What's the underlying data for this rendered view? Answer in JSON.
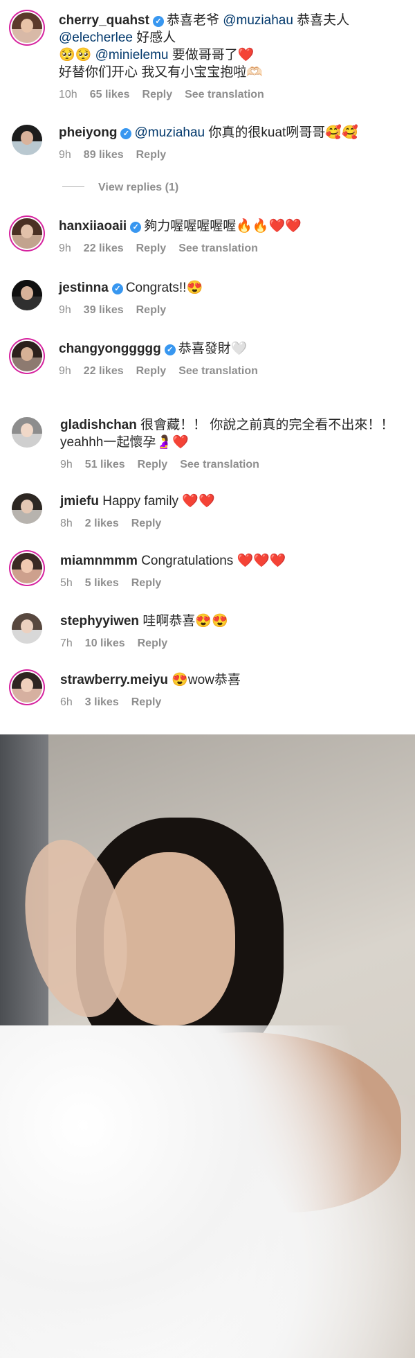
{
  "comments": [
    {
      "username": "cherry_quahst",
      "verified": true,
      "text_parts": [
        "恭喜老爷 ",
        "@muziahau",
        " 恭喜夫人"
      ],
      "line2_parts": [
        "@elecherlee",
        " 好感人"
      ],
      "line3_parts": [
        "🥺🥺 ",
        "@minielemu",
        " 要做哥哥了",
        "❤️"
      ],
      "line4": "好替你们开心 我又有小宝宝抱啦🫶🏻",
      "time": "10h",
      "likes": "65 likes",
      "reply": "Reply",
      "translation": "See translation"
    },
    {
      "username": "pheiyong",
      "verified": true,
      "text_parts": [
        "@muziahau",
        " 你真的很kuat咧哥哥🥰🥰"
      ],
      "time": "9h",
      "likes": "89 likes",
      "reply": "Reply"
    },
    {
      "view_replies": "View replies (1)"
    },
    {
      "username": "hanxiiaoaii",
      "verified": true,
      "text": "夠力喔喔喔喔喔🔥🔥❤️❤️",
      "time": "9h",
      "likes": "22 likes",
      "reply": "Reply",
      "translation": "See translation"
    },
    {
      "username": "jestinna",
      "verified": true,
      "text": "Congrats!!😍",
      "time": "9h",
      "likes": "39 likes",
      "reply": "Reply"
    },
    {
      "username": "changyonggggg",
      "verified": true,
      "text": "恭喜發財🤍",
      "time": "9h",
      "likes": "22 likes",
      "reply": "Reply",
      "translation": "See translation"
    },
    {
      "username": "gladishchan",
      "verified": false,
      "text": "很會藏！！ 你說之前真的完全看不出來！！",
      "text2": "yeahhh一起懷孕🤰❤️",
      "time": "9h",
      "likes": "51 likes",
      "reply": "Reply",
      "translation": "See translation"
    },
    {
      "username": "jmiefu",
      "verified": false,
      "text": "Happy family ❤️❤️",
      "time": "8h",
      "likes": "2 likes",
      "reply": "Reply"
    },
    {
      "username": "miamnmmm",
      "verified": false,
      "text": "Congratulations ❤️❤️❤️",
      "time": "5h",
      "likes": "5 likes",
      "reply": "Reply"
    },
    {
      "username": "stephyyiwen",
      "verified": false,
      "text": "哇啊恭喜😍😍",
      "time": "7h",
      "likes": "10 likes",
      "reply": "Reply"
    },
    {
      "username": "strawberry.meiyu",
      "verified": false,
      "text": "😍wow恭喜",
      "time": "6h",
      "likes": "3 likes",
      "reply": "Reply"
    }
  ],
  "colors": {
    "mention": "#00376b",
    "muted": "#8e8e8e",
    "verified": "#3897f0",
    "heart": "#ed1c24"
  },
  "icons": {
    "verified": "verified-icon"
  }
}
